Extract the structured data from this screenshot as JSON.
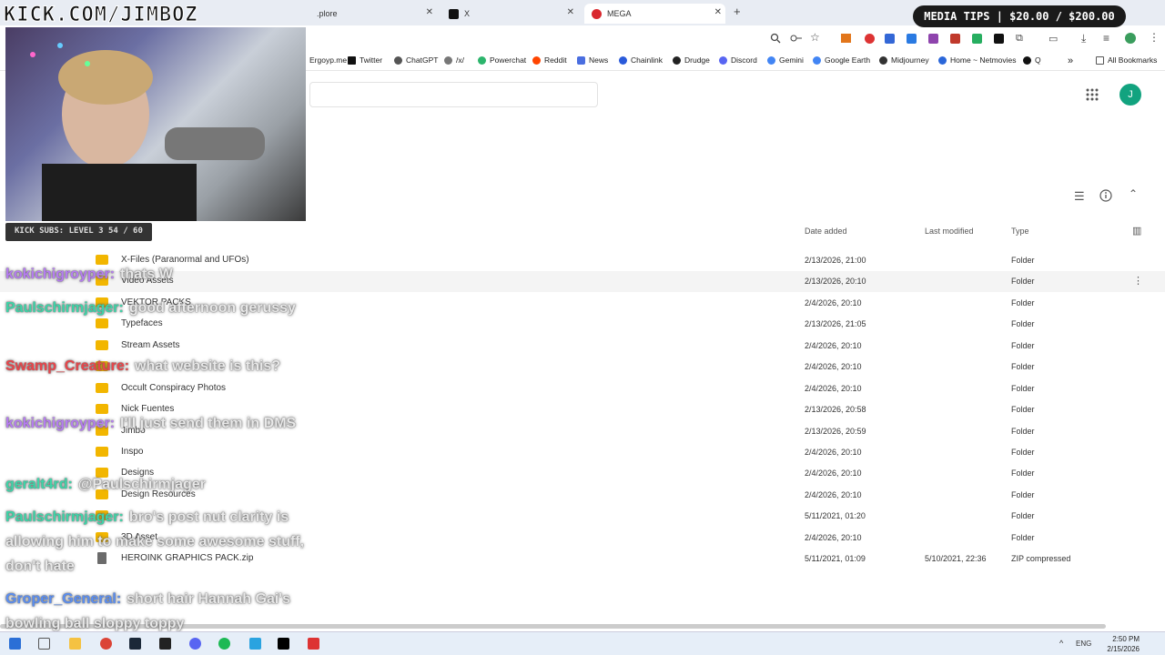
{
  "browser": {
    "tabs": [
      {
        "label": ".plore"
      },
      {
        "label": "X"
      },
      {
        "label": "MEGA"
      }
    ],
    "bookmarks": [
      "Ergoyp.me",
      "Twitter",
      "ChatGPT",
      "/x/",
      "Powerchat",
      "Reddit",
      "News",
      "Chainlink",
      "Drudge",
      "Discord",
      "Gemini",
      "Google Earth",
      "Midjourney",
      "Home ~ Netmovies",
      "Q"
    ],
    "all_bookmarks": "All Bookmarks"
  },
  "page": {
    "avatar_letter": "J",
    "columns": {
      "date_added": "Date added",
      "last_modified": "Last modified",
      "type": "Type"
    },
    "rows": [
      {
        "name": "X-Files (Paranormal and UFOs)",
        "date": "2/13/2026, 21:00",
        "modified": "",
        "type": "Folder"
      },
      {
        "name": "Video Assets",
        "date": "2/13/2026, 20:10",
        "modified": "",
        "type": "Folder"
      },
      {
        "name": "VEKTOR PACKS",
        "date": "2/4/2026, 20:10",
        "modified": "",
        "type": "Folder"
      },
      {
        "name": "Typefaces",
        "date": "2/13/2026, 21:05",
        "modified": "",
        "type": "Folder"
      },
      {
        "name": "Stream Assets",
        "date": "2/4/2026, 20:10",
        "modified": "",
        "type": "Folder"
      },
      {
        "name": "",
        "date": "2/4/2026, 20:10",
        "modified": "",
        "type": "Folder"
      },
      {
        "name": "Occult Conspiracy Photos",
        "date": "2/4/2026, 20:10",
        "modified": "",
        "type": "Folder"
      },
      {
        "name": "Nick Fuentes",
        "date": "2/13/2026, 20:58",
        "modified": "",
        "type": "Folder"
      },
      {
        "name": "Jimbo",
        "date": "2/13/2026, 20:59",
        "modified": "",
        "type": "Folder"
      },
      {
        "name": "Inspo",
        "date": "2/4/2026, 20:10",
        "modified": "",
        "type": "Folder"
      },
      {
        "name": "Designs",
        "date": "2/4/2026, 20:10",
        "modified": "",
        "type": "Folder"
      },
      {
        "name": "Design Resources",
        "date": "2/4/2026, 20:10",
        "modified": "",
        "type": "Folder"
      },
      {
        "name": "",
        "date": "5/11/2021, 01:20",
        "modified": "",
        "type": "Folder"
      },
      {
        "name": "3D Asset",
        "date": "2/4/2026, 20:10",
        "modified": "",
        "type": "Folder"
      },
      {
        "name": "HEROINK GRAPHICS PACK.zip",
        "date": "5/11/2021, 01:09",
        "modified": "5/10/2021, 22:36",
        "type": "ZIP compressed"
      }
    ]
  },
  "overlay": {
    "title": "KICK.COM/JIMBOZ",
    "media_tips": "MEDIA TIPS | $20.00 / $200.00",
    "kick_subs": "KICK SUBS: LEVEL 3 54 / 60",
    "chat": [
      {
        "user": "kokichigroyper:",
        "msg": "thats W",
        "color": "#b57cf0"
      },
      {
        "user": "Paulschirmjager:",
        "msg": "good afternoon gerussy",
        "color": "#3fd4a8"
      },
      {
        "user": "Swamp_Creature:",
        "msg": "what website is this?",
        "color": "#e8464b"
      },
      {
        "user": "kokichigroyper:",
        "msg": "I'll just send them in DMS",
        "color": "#b57cf0"
      },
      {
        "user": "geralt4rd:",
        "msg": "@Paulschirmjager",
        "color": "#3fd4a8"
      },
      {
        "user": "Paulschirmjager:",
        "msg": "bro's post nut clarity is allowing him to make some awesome stuff, don't hate",
        "color": "#3fd4a8"
      },
      {
        "user": "Groper_General:",
        "msg": "short hair Hannah Gai's bowling ball sloppy toppy",
        "color": "#5b8ef0"
      }
    ]
  },
  "taskbar": {
    "lang": "ENG",
    "time": "2:50 PM",
    "date": "2/15/2026"
  }
}
